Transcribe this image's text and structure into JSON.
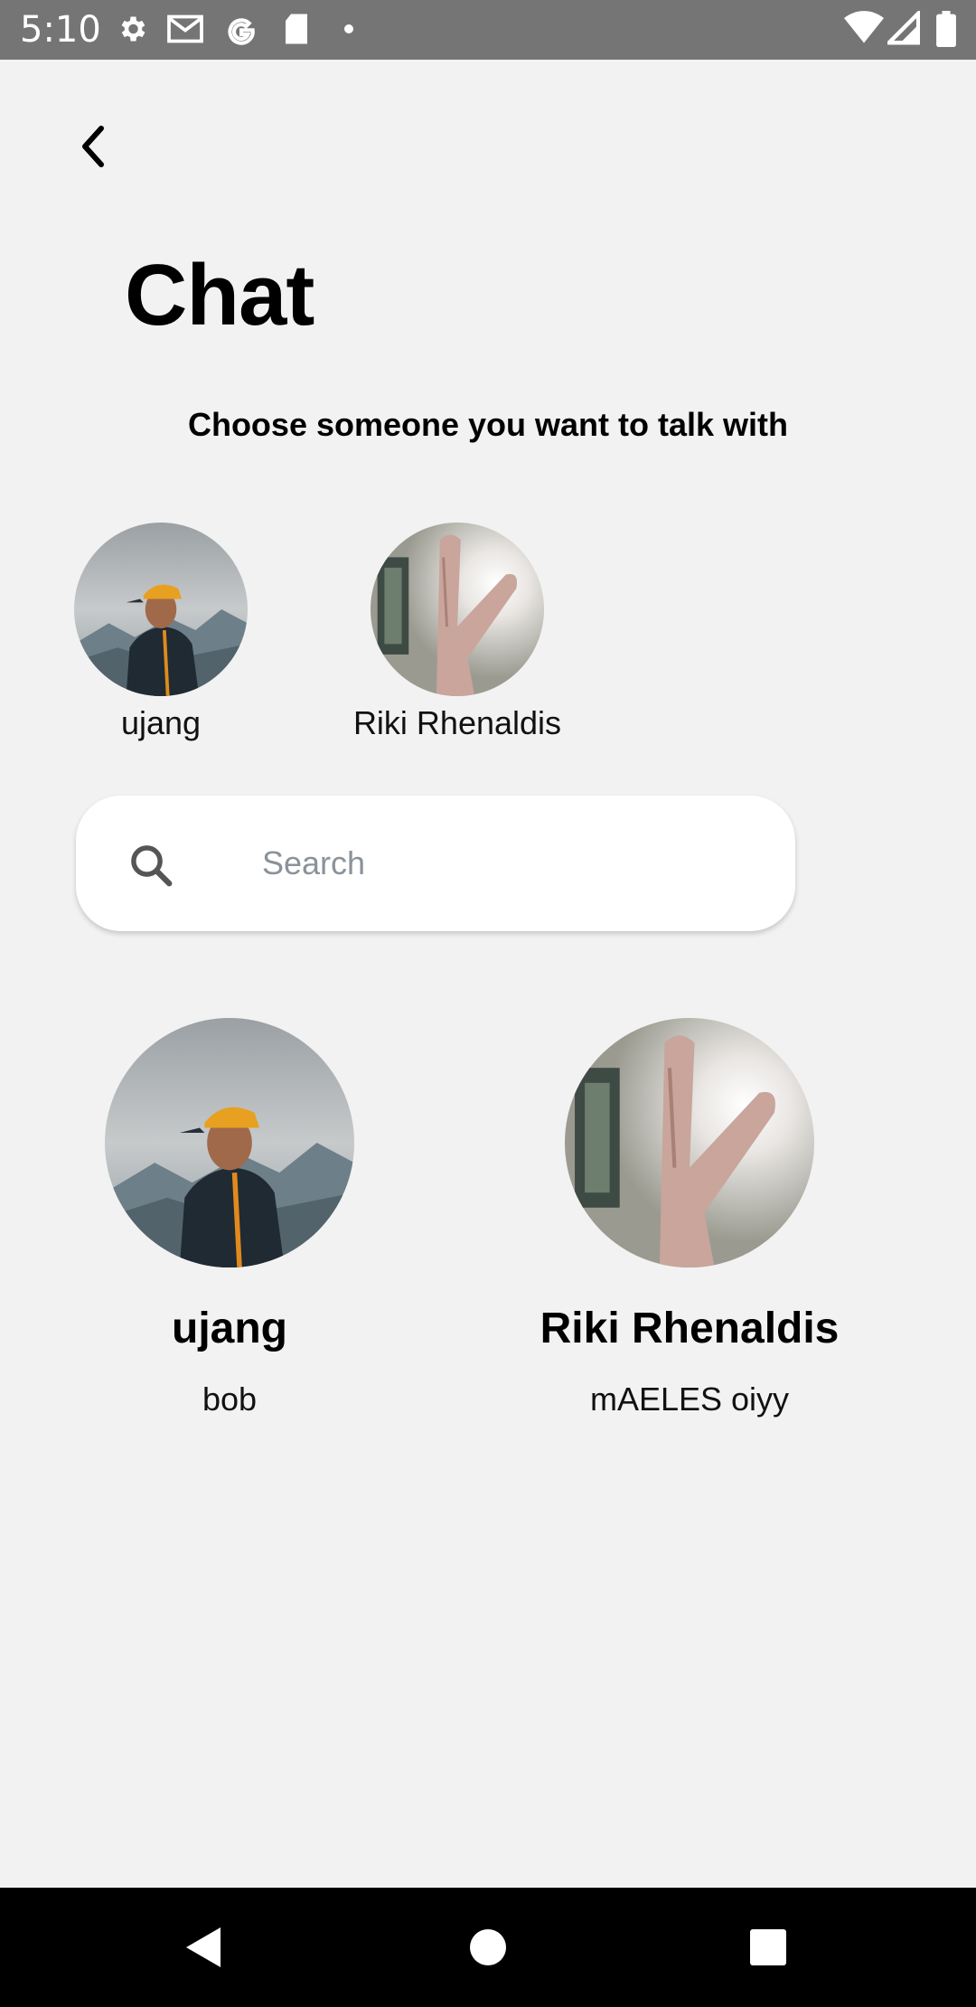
{
  "status_bar": {
    "time": "5:10",
    "left_icons": [
      "gear-icon",
      "gmail-icon",
      "google-icon",
      "sd-card-icon",
      "dot-icon"
    ],
    "right_icons": [
      "wifi-icon",
      "signal-icon",
      "battery-icon"
    ]
  },
  "header": {
    "back_icon": "chevron-left-icon",
    "title": "Chat",
    "subtitle": "Choose someone you want to talk with"
  },
  "recent": [
    {
      "name": "ujang",
      "avatar": "person-orange-cap-photo"
    },
    {
      "name": "Riki Rhenaldis",
      "avatar": "hand-peace-sign-photo"
    }
  ],
  "search": {
    "placeholder": "Search",
    "value": "",
    "icon": "search-icon"
  },
  "contacts": [
    {
      "name": "ujang",
      "message": "bob",
      "avatar": "person-orange-cap-photo"
    },
    {
      "name": "Riki Rhenaldis",
      "message": "mAELES oiyy",
      "avatar": "hand-peace-sign-photo"
    }
  ],
  "nav_bar": {
    "buttons": [
      "back-triangle-icon",
      "home-circle-icon",
      "recents-square-icon"
    ]
  },
  "colors": {
    "background": "#f2f2f2",
    "status_bar": "#757575",
    "nav_bar": "#000000",
    "search_bg": "#ffffff",
    "placeholder": "#8a929a"
  }
}
